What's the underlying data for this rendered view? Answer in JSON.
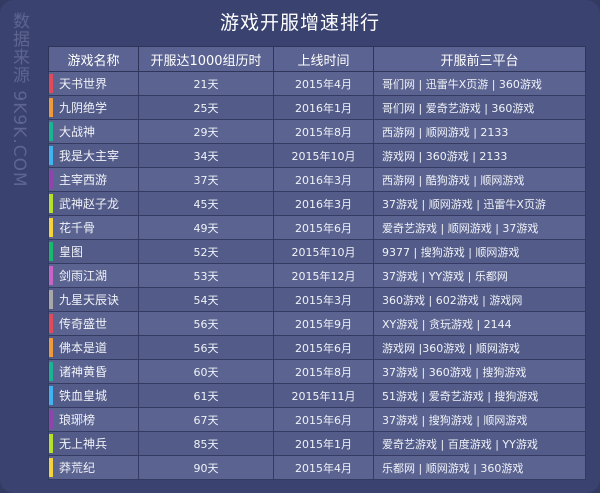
{
  "title": "游戏开服增速排行",
  "watermark": "数据来源 9K9K.COM",
  "headers": [
    "游戏名称",
    "开服达1000组历时",
    "上线时间",
    "开服前三平台"
  ],
  "rows": [
    {
      "name": "天书世界",
      "days": "21天",
      "launch": "2015年4月",
      "platforms": "哥们网 | 迅雷牛X页游 | 360游戏",
      "color": "#e14a5a"
    },
    {
      "name": "九阴绝学",
      "days": "25天",
      "launch": "2016年1月",
      "platforms": "哥们网 | 爱奇艺游戏 | 360游戏",
      "color": "#f09a3e"
    },
    {
      "name": "大战神",
      "days": "29天",
      "launch": "2015年8月",
      "platforms": "西游网 | 顺网游戏 | 2133",
      "color": "#1ab394"
    },
    {
      "name": "我是大主宰",
      "days": "34天",
      "launch": "2015年10月",
      "platforms": "游戏网 | 360游戏 | 2133",
      "color": "#3fb4f0"
    },
    {
      "name": "主宰西游",
      "days": "37天",
      "launch": "2016年3月",
      "platforms": "西游网 | 酷狗游戏 | 顺网游戏",
      "color": "#8e44ad"
    },
    {
      "name": "武神赵子龙",
      "days": "45天",
      "launch": "2016年3月",
      "platforms": "37游戏 | 顺网游戏 | 迅雷牛X页游",
      "color": "#b5e02c"
    },
    {
      "name": "花千骨",
      "days": "49天",
      "launch": "2015年6月",
      "platforms": "爱奇艺游戏 | 顺网游戏 | 37游戏",
      "color": "#f5d33b"
    },
    {
      "name": "皇图",
      "days": "52天",
      "launch": "2015年10月",
      "platforms": "9377 | 搜狗游戏 | 顺网游戏",
      "color": "#18b86e"
    },
    {
      "name": "剑雨江湖",
      "days": "53天",
      "launch": "2015年12月",
      "platforms": "37游戏 | YY游戏 | 乐都网",
      "color": "#c864c8"
    },
    {
      "name": "九星天辰诀",
      "days": "54天",
      "launch": "2015年3月",
      "platforms": "360游戏 | 602游戏 | 游戏网",
      "color": "#a8a8a8"
    },
    {
      "name": "传奇盛世",
      "days": "56天",
      "launch": "2015年9月",
      "platforms": "XY游戏 | 贪玩游戏 | 2144",
      "color": "#e14a5a"
    },
    {
      "name": "佛本是道",
      "days": "56天",
      "launch": "2015年6月",
      "platforms": "游戏网 |360游戏 | 顺网游戏",
      "color": "#f09a3e"
    },
    {
      "name": "诸神黄昏",
      "days": "60天",
      "launch": "2015年8月",
      "platforms": "37游戏 | 360游戏 | 搜狗游戏",
      "color": "#1ab394"
    },
    {
      "name": "铁血皇城",
      "days": "61天",
      "launch": "2015年11月",
      "platforms": "51游戏 | 爱奇艺游戏 | 搜狗游戏",
      "color": "#3fb4f0"
    },
    {
      "name": "琅琊榜",
      "days": "67天",
      "launch": "2015年6月",
      "platforms": "37游戏 | 搜狗游戏 | 顺网游戏",
      "color": "#8e44ad"
    },
    {
      "name": "无上神兵",
      "days": "85天",
      "launch": "2015年1月",
      "platforms": "爱奇艺游戏 | 百度游戏 | YY游戏",
      "color": "#b5e02c"
    },
    {
      "name": "莽荒纪",
      "days": "90天",
      "launch": "2015年4月",
      "platforms": "乐都网 | 顺网游戏 | 360游戏",
      "color": "#f5d33b"
    }
  ]
}
